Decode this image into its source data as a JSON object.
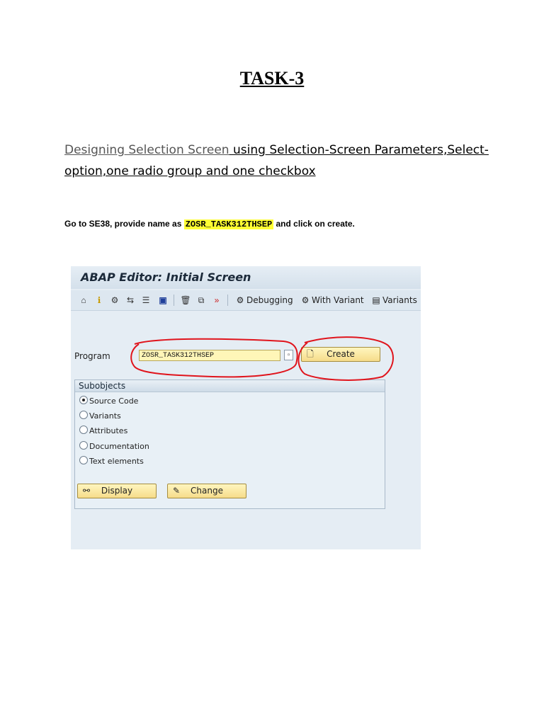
{
  "doc": {
    "title": "TASK-3",
    "subtitle_part1": "Designing Selection Screen",
    "subtitle_part2": " using Selection-Screen Parameters,Select-option,one radio group and one checkbox",
    "instruction_before": "Go to SE38, provide name as ",
    "instruction_highlight": "ZOSR_TASK312THSEP",
    "instruction_after": "  and click on create."
  },
  "sap": {
    "title": "ABAP Editor: Initial Screen",
    "toolbar": {
      "icons": [
        "display-other-icon",
        "info-icon",
        "activate-icon",
        "where-used-icon",
        "object-list-icon",
        "info-block-icon",
        "delete-icon",
        "copy-icon",
        "execute-icon"
      ],
      "debugging_label": "Debugging",
      "with_variant_label": "With Variant",
      "variants_label": "Variants"
    },
    "program_label": "Program",
    "program_value": "ZOSR_TASK312THSEP",
    "create_label": "Create",
    "subobjects": {
      "title": "Subobjects",
      "options": [
        {
          "label": "Source Code",
          "selected": true
        },
        {
          "label": "Variants",
          "selected": false
        },
        {
          "label": "Attributes",
          "selected": false
        },
        {
          "label": "Documentation",
          "selected": false
        },
        {
          "label": "Text elements",
          "selected": false
        }
      ]
    },
    "display_label": "Display",
    "change_label": "Change"
  },
  "colors": {
    "highlight": "#ffff33",
    "annotation": "#e0141c",
    "input_bg": "#fff6b8"
  }
}
